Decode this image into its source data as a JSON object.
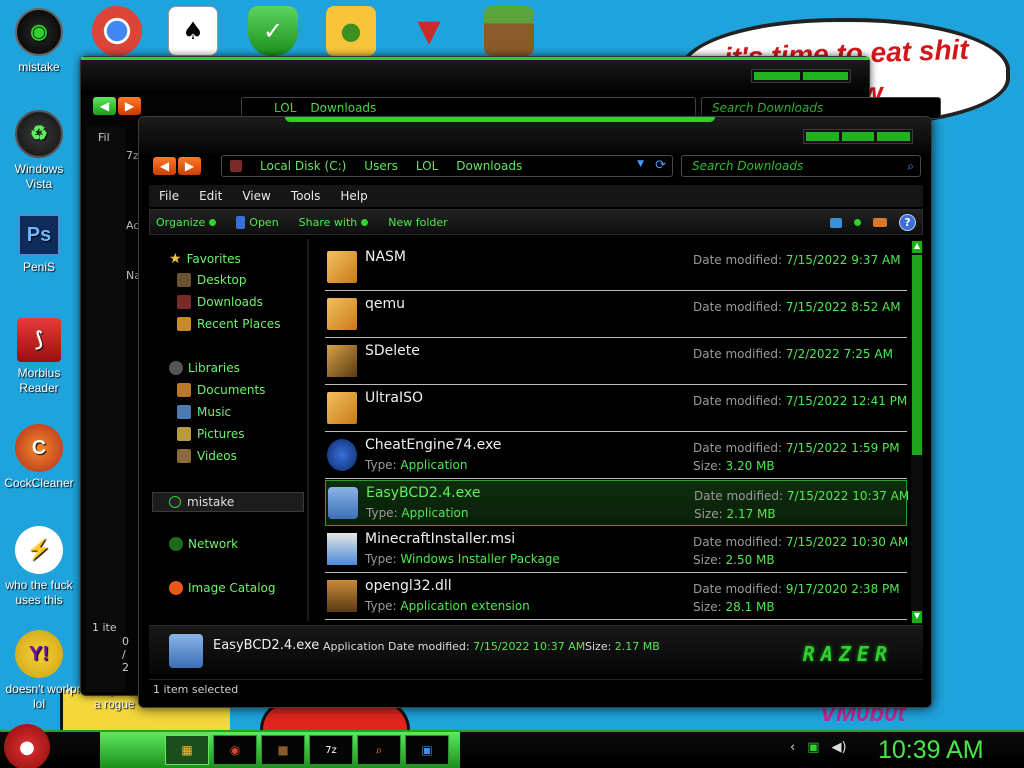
{
  "wallpaper": {
    "bubble_text": "it's time to eat shit chew",
    "watermark": "VM0b0t"
  },
  "desktop_icons": [
    {
      "label": "mistake",
      "icon": "mistake-icon"
    },
    {
      "label": "Windows Vista",
      "icon": "recycle-icon"
    },
    {
      "label": "PeniS",
      "icon": "photoshop-icon"
    },
    {
      "label": "Morbius Reader",
      "icon": "pdf-reader-icon"
    },
    {
      "label": "CockCleaner",
      "icon": "cleaner-icon"
    },
    {
      "label": "who the fuck uses this",
      "icon": "lightning-icon"
    },
    {
      "label": "doesn't work lol",
      "icon": "yahoo-icon"
    }
  ],
  "desktop_partial_labels": [
    "probably r",
    "a rogue"
  ],
  "top_icons": [
    "chrome-icon",
    "solitaire-icon",
    "shield-check-icon",
    "bad-piggies-icon",
    "winamp-icon",
    "minecraft-icon"
  ],
  "back_window": {
    "breadcrumb": [
      "LOL",
      "Downloads"
    ],
    "search_placeholder": "Search Downloads",
    "strip_labels": [
      "Fil",
      "7z",
      "Ac",
      "Na",
      "1 ite",
      "0 / 2"
    ]
  },
  "window": {
    "breadcrumb": [
      "Local Disk (C:)",
      "Users",
      "LOL",
      "Downloads"
    ],
    "search_placeholder": "Search Downloads",
    "menu": [
      "File",
      "Edit",
      "View",
      "Tools",
      "Help"
    ],
    "commands": [
      "Organize",
      "Open",
      "Share with",
      "New folder"
    ],
    "nav": {
      "favorites": "Favorites",
      "favorite_items": [
        "Desktop",
        "Downloads",
        "Recent Places"
      ],
      "libraries": "Libraries",
      "library_items": [
        "Documents",
        "Music",
        "Pictures",
        "Videos"
      ],
      "homegroup": "mistake",
      "network": "Network",
      "catalog": "Image Catalog"
    },
    "date_label": "Date modified:",
    "type_label": "Type:",
    "size_label": "Size:",
    "files": [
      {
        "name": "NASM",
        "date": "7/15/2022 9:37 AM",
        "type": "",
        "size": "",
        "kind": "folder"
      },
      {
        "name": "qemu",
        "date": "7/15/2022 8:52 AM",
        "type": "",
        "size": "",
        "kind": "folder"
      },
      {
        "name": "SDelete",
        "date": "7/2/2022 7:25 AM",
        "type": "",
        "size": "",
        "kind": "folder-dark"
      },
      {
        "name": "UltraISO",
        "date": "7/15/2022 12:41 PM",
        "type": "",
        "size": "",
        "kind": "folder"
      },
      {
        "name": "CheatEngine74.exe",
        "date": "7/15/2022 1:59 PM",
        "type": "Application",
        "size": "3.20 MB",
        "kind": "cheatengine"
      },
      {
        "name": "EasyBCD2.4.exe",
        "date": "7/15/2022 10:37 AM",
        "type": "Application",
        "size": "2.17 MB",
        "kind": "easybcd"
      },
      {
        "name": "MinecraftInstaller.msi",
        "date": "7/15/2022 10:30 AM",
        "type": "Windows Installer Package",
        "size": "2.50 MB",
        "kind": "msi"
      },
      {
        "name": "opengl32.dll",
        "date": "9/17/2020 2:38 PM",
        "type": "Application extension",
        "size": "28.1 MB",
        "kind": "dll"
      }
    ],
    "selected_index": 5,
    "details": {
      "name": "EasyBCD2.4.exe",
      "type": "Application",
      "date_label": "Date modified:",
      "date": "7/15/2022 10:37 AM",
      "size_label": "Size:",
      "size": "2.17 MB",
      "brand": "RAZER"
    },
    "status": "1 item selected"
  },
  "taskbar": {
    "apps": [
      "explorer-icon",
      "chrome-icon",
      "minecraft-icon",
      "7zip-icon",
      "search-icon",
      "installer-icon"
    ],
    "clock": "10:39 AM"
  }
}
